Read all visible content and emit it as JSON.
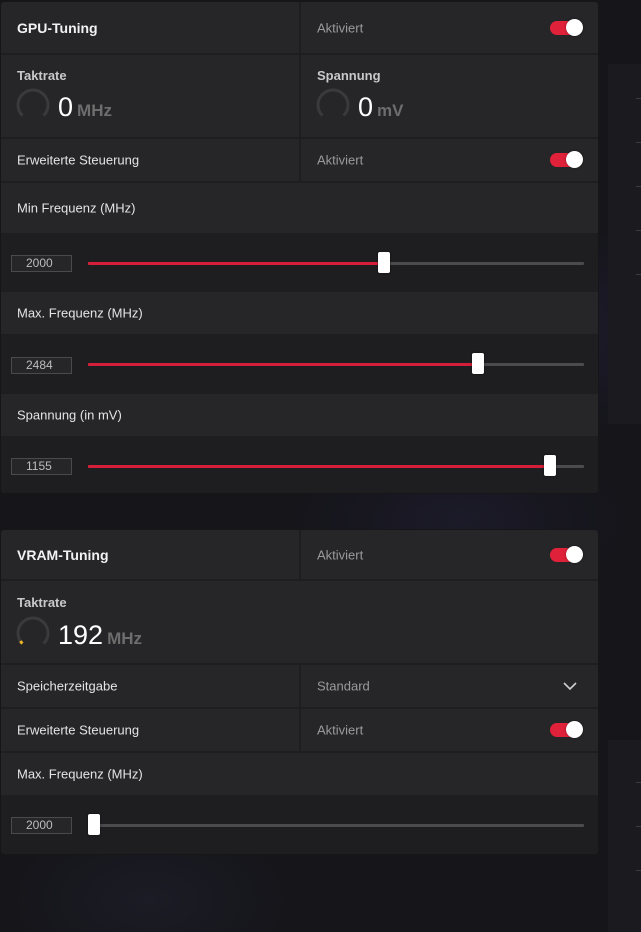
{
  "gpu": {
    "title": "GPU-Tuning",
    "status": "Aktiviert",
    "enabled": true,
    "clock": {
      "label": "Taktrate",
      "value": "0",
      "unit": "MHz"
    },
    "voltage": {
      "label": "Spannung",
      "value": "0",
      "unit": "mV"
    },
    "advanced": {
      "label": "Erweiterte Steuerung",
      "status": "Aktiviert",
      "enabled": true
    },
    "sliders": [
      {
        "label": "Min Frequenz (MHz)",
        "value": "2000",
        "fraction": 0.597
      },
      {
        "label": "Max. Frequenz (MHz)",
        "value": "2484",
        "fraction": 0.786
      },
      {
        "label": "Spannung (in mV)",
        "value": "1155",
        "fraction": 0.931
      }
    ]
  },
  "vram": {
    "title": "VRAM-Tuning",
    "status": "Aktiviert",
    "enabled": true,
    "clock": {
      "label": "Taktrate",
      "value": "192",
      "unit": "MHz"
    },
    "timing": {
      "label": "Speicherzeitgabe",
      "value": "Standard"
    },
    "advanced": {
      "label": "Erweiterte Steuerung",
      "status": "Aktiviert",
      "enabled": true
    },
    "sliders": [
      {
        "label": "Max. Frequenz (MHz)",
        "value": "2000",
        "fraction": 0.012
      }
    ]
  },
  "colors": {
    "accent": "#e0213a",
    "gauge_idle": "#3a3a3c",
    "gauge_active": "#f0b429"
  }
}
